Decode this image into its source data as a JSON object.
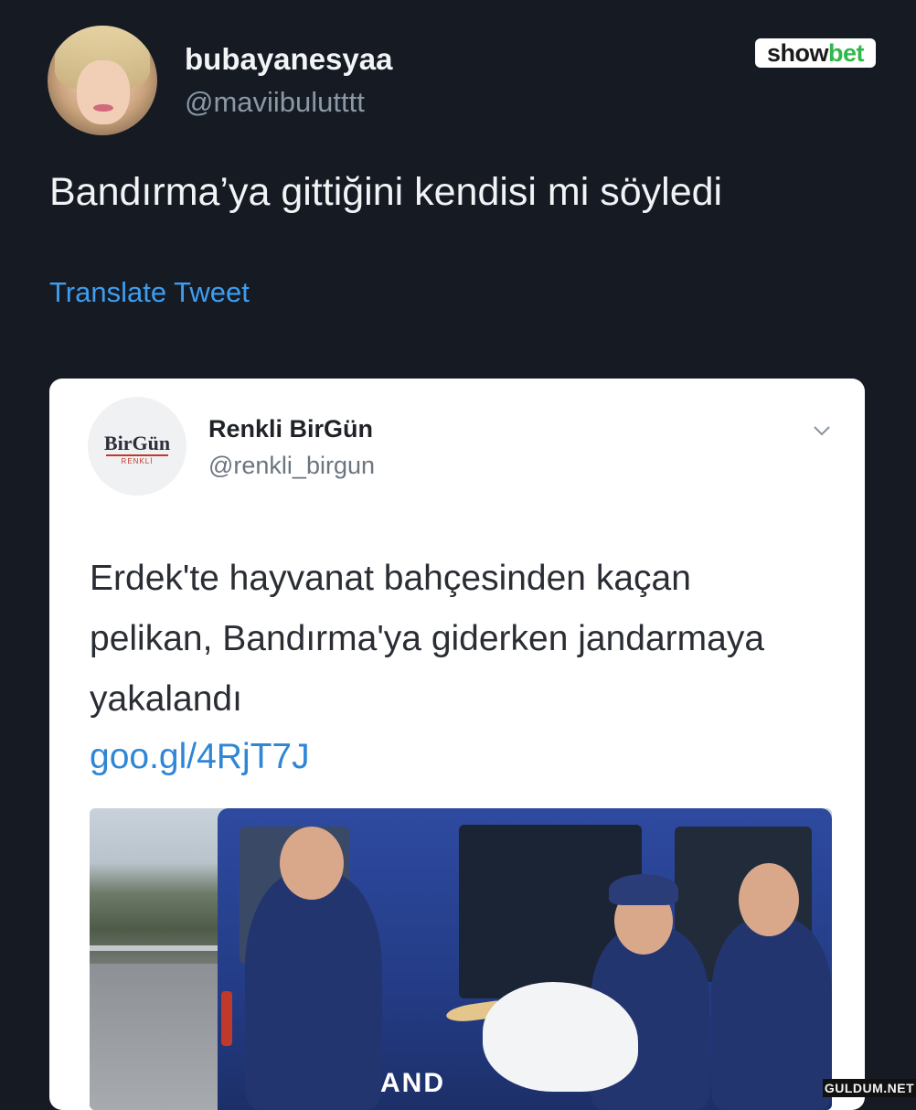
{
  "tweet": {
    "display_name": "bubayanesyaa",
    "handle": "@maviibulutttt",
    "text": "Bandırma’ya gittiğini kendisi mi söyledi",
    "translate_label": "Translate Tweet"
  },
  "brand_badge": {
    "part1": "show",
    "part2": "bet"
  },
  "quoted": {
    "logo_text": "BirGün",
    "logo_sub": "RENKLİ",
    "display_name": "Renkli BirGün",
    "handle": "@renkli_birgun",
    "text": "Erdek'te hayvanat bahçesinden kaçan pelikan, Bandırma'ya giderken jandarmaya yakalandı",
    "link": "goo.gl/4RjT7J",
    "photo_text": "AND"
  },
  "watermark": "GULDUM.NET",
  "colors": {
    "background": "#151a23",
    "link": "#3d9ef0",
    "card_link": "#2f86d6",
    "badge_accent": "#2fb84c"
  }
}
